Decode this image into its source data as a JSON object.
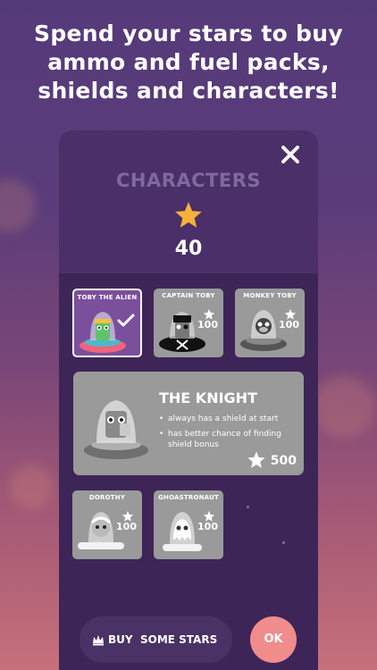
{
  "headline": {
    "line1": "Spend your stars to buy",
    "line2": "ammo and fuel packs,",
    "line3": "shields and characters!"
  },
  "panel": {
    "title": "CHARACTERS",
    "stars": "40",
    "close_icon": "close-icon"
  },
  "characters": [
    {
      "name": "TOBY THE ALIEN",
      "selected": true
    },
    {
      "name": "CAPTAIN TOBY",
      "price": "100"
    },
    {
      "name": "MONKEY TOBY",
      "price": "100"
    }
  ],
  "featured": {
    "title": "THE KNIGHT",
    "bullet1": "always has a shield at start",
    "bullet2_line1": "has better chance of finding",
    "bullet2_line2": "shield bonus",
    "price": "500"
  },
  "characters_row2": [
    {
      "name": "DOROTHY",
      "price": "100"
    },
    {
      "name": "GHOASTRONAUT",
      "price": "100"
    }
  ],
  "footer": {
    "buy_word": "BUY",
    "buy_rest": "SOME STARS",
    "ok_label": "OK"
  },
  "colors": {
    "star": "#f5b13a",
    "panel": "#3d2558",
    "locked_card": "#9a9a9a",
    "ok_button": "#f08c8c"
  }
}
